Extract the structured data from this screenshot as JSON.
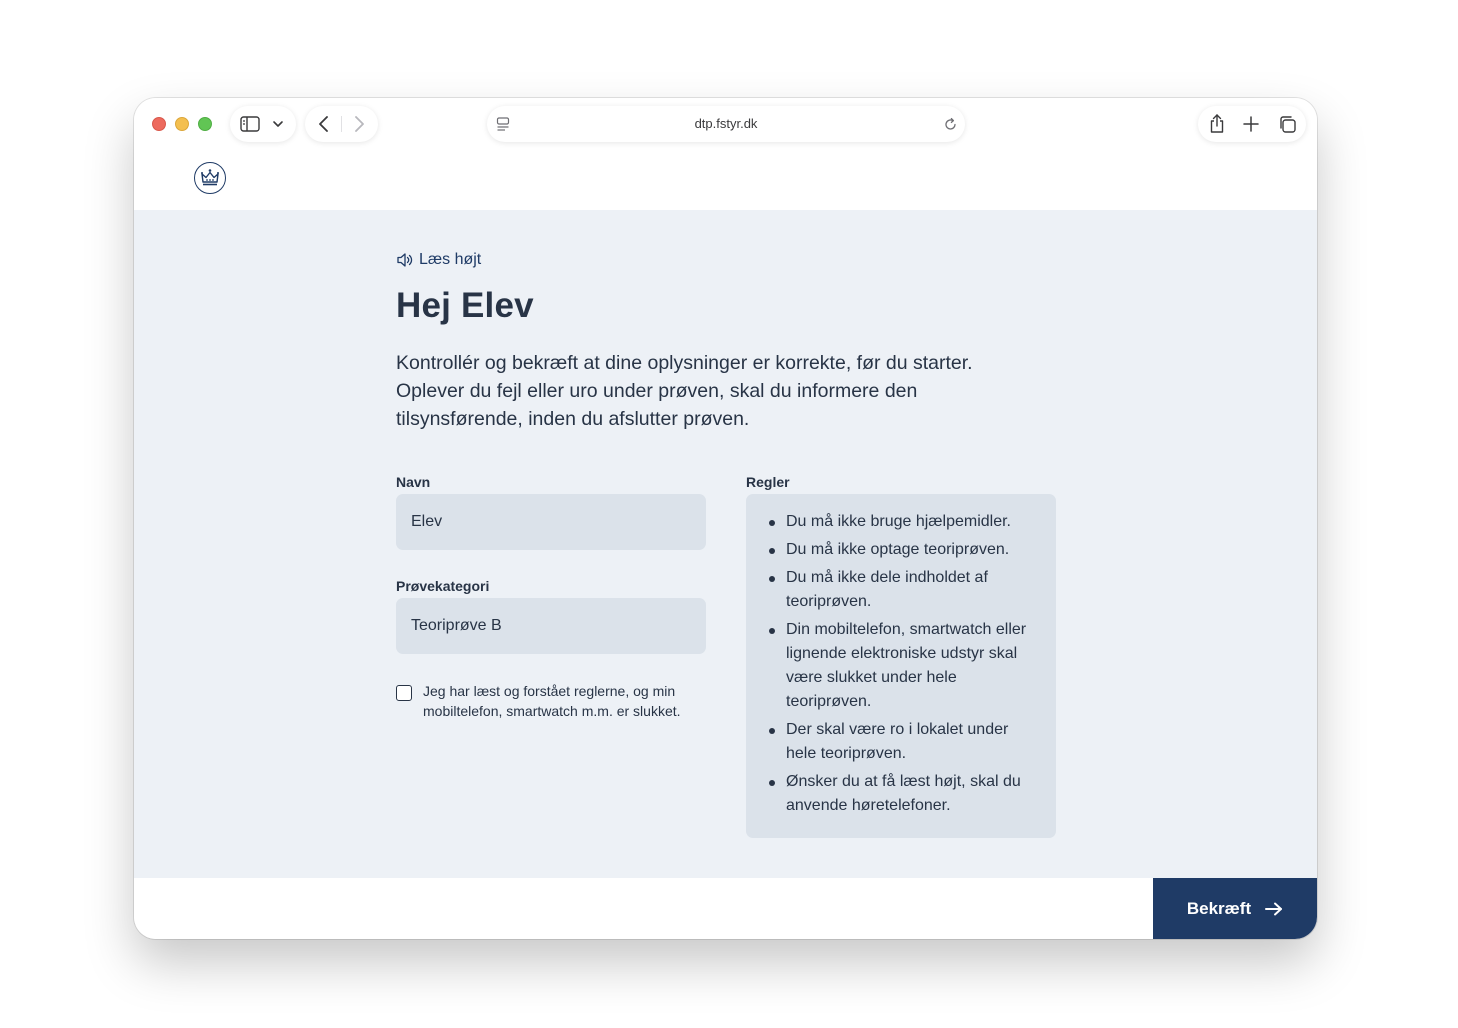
{
  "browser": {
    "url": "dtp.fstyr.dk"
  },
  "page": {
    "read_aloud": "Læs højt",
    "title": "Hej Elev",
    "intro": "Kontrollér og bekræft at dine oplysninger er korrekte, før du starter. Oplever du fejl eller uro under prøven, skal du informere den tilsynsførende, inden du afslutter prøven."
  },
  "form": {
    "name_label": "Navn",
    "name_value": "Elev",
    "category_label": "Prøvekategori",
    "category_value": "Teoriprøve B",
    "consent_label": "Jeg har læst og forstået reglerne, og min mobiltelefon, smartwatch m.m. er slukket.",
    "consent_checked": false
  },
  "rules": {
    "label": "Regler",
    "items": [
      "Du må ikke bruge hjælpemidler.",
      "Du må ikke optage teoriprøven.",
      "Du må ikke dele indholdet af teoriprøven.",
      "Din mobiltelefon, smartwatch eller lignende elektroniske udstyr skal være slukket under hele teoriprøven.",
      "Der skal være ro i lokalet under hele teoriprøven.",
      "Ønsker du at få læst højt, skal du anvende høretelefoner."
    ]
  },
  "footer": {
    "confirm_label": "Bekræft"
  },
  "colors": {
    "primary": "#1f3b66",
    "background": "#edf1f6",
    "field": "#dbe2ea",
    "text": "#283446"
  },
  "icons": {
    "read_aloud": "speaker-icon",
    "confirm": "arrow-right-icon",
    "logo": "crown-icon"
  }
}
